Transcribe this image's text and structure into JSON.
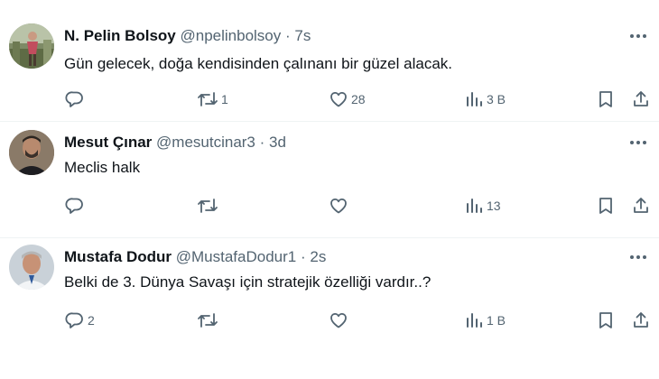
{
  "tweets": [
    {
      "name": "N. Pelin Bolsoy",
      "handle": "@npelinbolsoy",
      "separator": "·",
      "time": "7s",
      "text": "Gün gelecek, doğa kendisinden çalınanı bir güzel alacak.",
      "reply_count": "",
      "retweet_count": "1",
      "like_count": "28",
      "view_count": "3 B"
    },
    {
      "name": "Mesut Çınar",
      "handle": "@mesutcinar3",
      "separator": "·",
      "time": "3d",
      "text": "Meclis halk",
      "reply_count": "",
      "retweet_count": "",
      "like_count": "",
      "view_count": "13"
    },
    {
      "name": "Mustafa Dodur",
      "handle": "@MustafaDodur1",
      "separator": "·",
      "time": "2s",
      "text": "Belki de 3. Dünya Savaşı için stratejik özelliği vardır..?",
      "reply_count": "2",
      "retweet_count": "",
      "like_count": "",
      "view_count": "1 B"
    }
  ],
  "icons": {
    "reply": "reply-icon",
    "retweet": "retweet-icon",
    "like": "heart-icon",
    "views": "views-chart-icon",
    "bookmark": "bookmark-icon",
    "share": "share-icon",
    "more": "more-options-icon"
  },
  "colors": {
    "text": "#0f1419",
    "secondary": "#536471",
    "divider": "#eff3f4",
    "background": "#ffffff"
  }
}
